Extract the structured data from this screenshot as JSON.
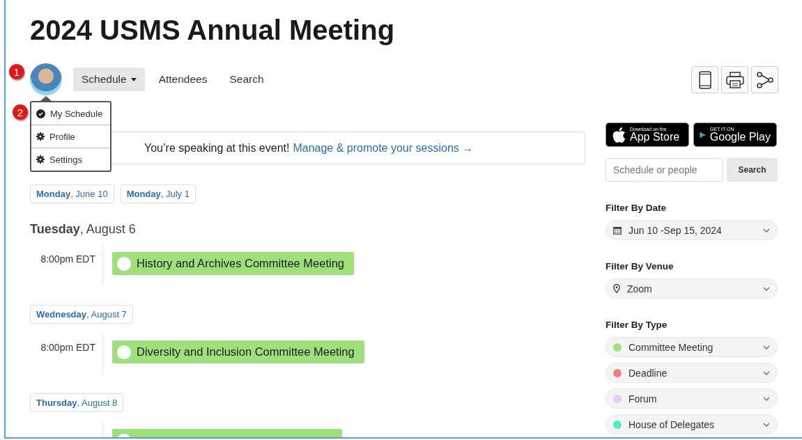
{
  "title": "2024 USMS Annual Meeting",
  "callouts": [
    {
      "number": "1"
    },
    {
      "number": "2"
    }
  ],
  "nav": [
    {
      "label": "Schedule",
      "selected": true,
      "dropdown": true
    },
    {
      "label": "Attendees",
      "selected": false,
      "dropdown": false
    },
    {
      "label": "Search",
      "selected": false,
      "dropdown": false
    }
  ],
  "user_menu": {
    "open": true,
    "items": [
      {
        "label": "My Schedule",
        "kind": "check"
      },
      {
        "label": "Profile",
        "kind": "gear"
      },
      {
        "label": "Settings",
        "kind": "gear"
      }
    ]
  },
  "toolbar": [
    {
      "kind": "phone"
    },
    {
      "kind": "print"
    },
    {
      "kind": "share"
    }
  ],
  "banner": {
    "text": "You’re speaking at this event!",
    "link": "Manage & promote your sessions →"
  },
  "date_links": [
    {
      "label": "**Monday**, June 10"
    },
    {
      "label": "**Monday**, July 1"
    }
  ],
  "days": [
    {
      "kind": "heading",
      "label": "**Tuesday**, August 6",
      "sessions": [
        {
          "time": "8:00pm EDT",
          "title": "History and Archives Committee Meeting",
          "color": "#a0e07c"
        }
      ]
    },
    {
      "kind": "link",
      "label": "**Wednesday**, August 7",
      "sessions": [
        {
          "time": "8:00pm EDT",
          "title": "Diversity and Inclusion Committee Meeting",
          "color": "#a0e07c"
        }
      ]
    },
    {
      "kind": "link",
      "label": "**Thursday**, August 8",
      "sessions": [
        {
          "color": "#a0e07c"
        }
      ]
    }
  ],
  "app_badges": [
    {
      "kind": "apple",
      "small": "Download on the",
      "big": "App Store"
    },
    {
      "kind": "google",
      "small": "GET IT ON",
      "big": "Google Play"
    }
  ],
  "search": {
    "placeholder": "Schedule or people",
    "button": "Search"
  },
  "filters": [
    {
      "label": "Filter By Date",
      "options": [
        {
          "kind": "calendar",
          "value": "Jun 10 -Sep 15, 2024"
        }
      ]
    },
    {
      "label": "Filter By Venue",
      "options": [
        {
          "kind": "pin",
          "value": "Zoom"
        }
      ]
    },
    {
      "label": "Filter By Type",
      "options": [
        {
          "value": "Committee Meeting",
          "color": "#9ee07a"
        },
        {
          "value": "Deadline",
          "color": "#f08080"
        },
        {
          "value": "Forum",
          "color": "#eac8f8"
        },
        {
          "value": "House of Delegates",
          "color": "#4cecc4"
        }
      ]
    }
  ]
}
